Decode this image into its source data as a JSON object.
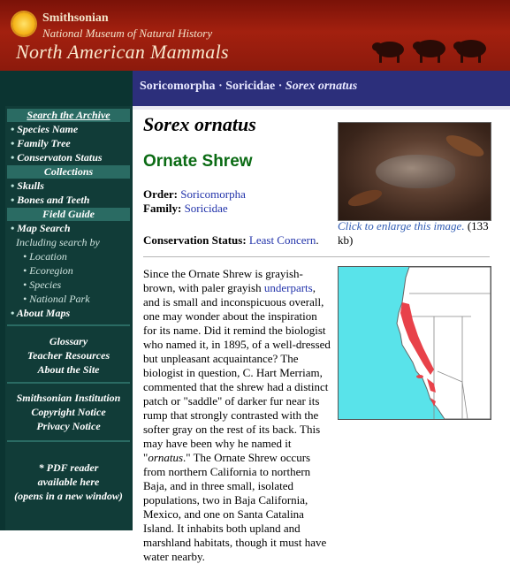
{
  "banner": {
    "institution": "Smithsonian",
    "museum": "National Museum of Natural History",
    "title": "North American Mammals",
    "colors": {
      "banner": "#8c1a0c",
      "text": "#f2e3c9"
    }
  },
  "breadcrumb": {
    "order": "Soricomorpha",
    "sep1": " · ",
    "family": "Soricidae",
    "sep2": " · ",
    "species": "Sorex ornatus"
  },
  "sidebar": {
    "search_archive": "Search the Archive",
    "items_archive": [
      "Species Name",
      "Family Tree",
      "Conservaton Status"
    ],
    "collections": "Collections",
    "items_collections": [
      "Skulls",
      "Bones and Teeth"
    ],
    "field_guide": "Field Guide",
    "map_search": "Map Search",
    "including": "Including search by",
    "sub_items": [
      "Location",
      "Ecoregion",
      "Species",
      "National Park"
    ],
    "about_maps": "About Maps",
    "links1": [
      "Glossary",
      "Teacher Resources",
      "About the Site"
    ],
    "links2": [
      "Smithsonian Institution",
      "Copyright Notice",
      "Privacy Notice"
    ],
    "pdf_note": [
      "* PDF reader",
      "available here",
      "(opens in a new window)"
    ],
    "bullet": "•"
  },
  "content": {
    "scientific_name": "Sorex ornatus",
    "common_name": "Ornate Shrew",
    "order_label": "Order:",
    "order_value": "Soricomorpha",
    "family_label": "Family:",
    "family_value": "Soricidae",
    "conservation_label": "Conservation Status:",
    "conservation_value": "Least Concern",
    "period": ".",
    "caption_link": "Click to enlarge this image.",
    "caption_size": "(133 kb)",
    "paragraph_parts": {
      "p1": "Since the Ornate Shrew is grayish-brown, with paler grayish ",
      "link": "underparts",
      "p2": ", and is small and inconspicuous overall, one may wonder about the inspiration for its name. Did it remind the biologist who named it, in 1895, of a well-dressed but unpleasant acquaintance? The biologist in question, C. Hart Merriam, commented that the shrew had a distinct patch or \"saddle\" of darker fur near its rump that strongly contrasted with the softer gray on the rest of its back. This may have been why he named it \"",
      "em": "ornatus",
      "p3": ".\" The Ornate Shrew occurs from northern California to northern Baja, and in three small, isolated populations, two in Baja California, Mexico, and one on Santa Catalina Island. It inhabits both upland and marshland habitats, though it must have water nearby."
    },
    "colors": {
      "common_name": "#0b6b14",
      "link": "#2233aa",
      "map_water": "#59e3ea",
      "range": "#e8424a"
    }
  }
}
